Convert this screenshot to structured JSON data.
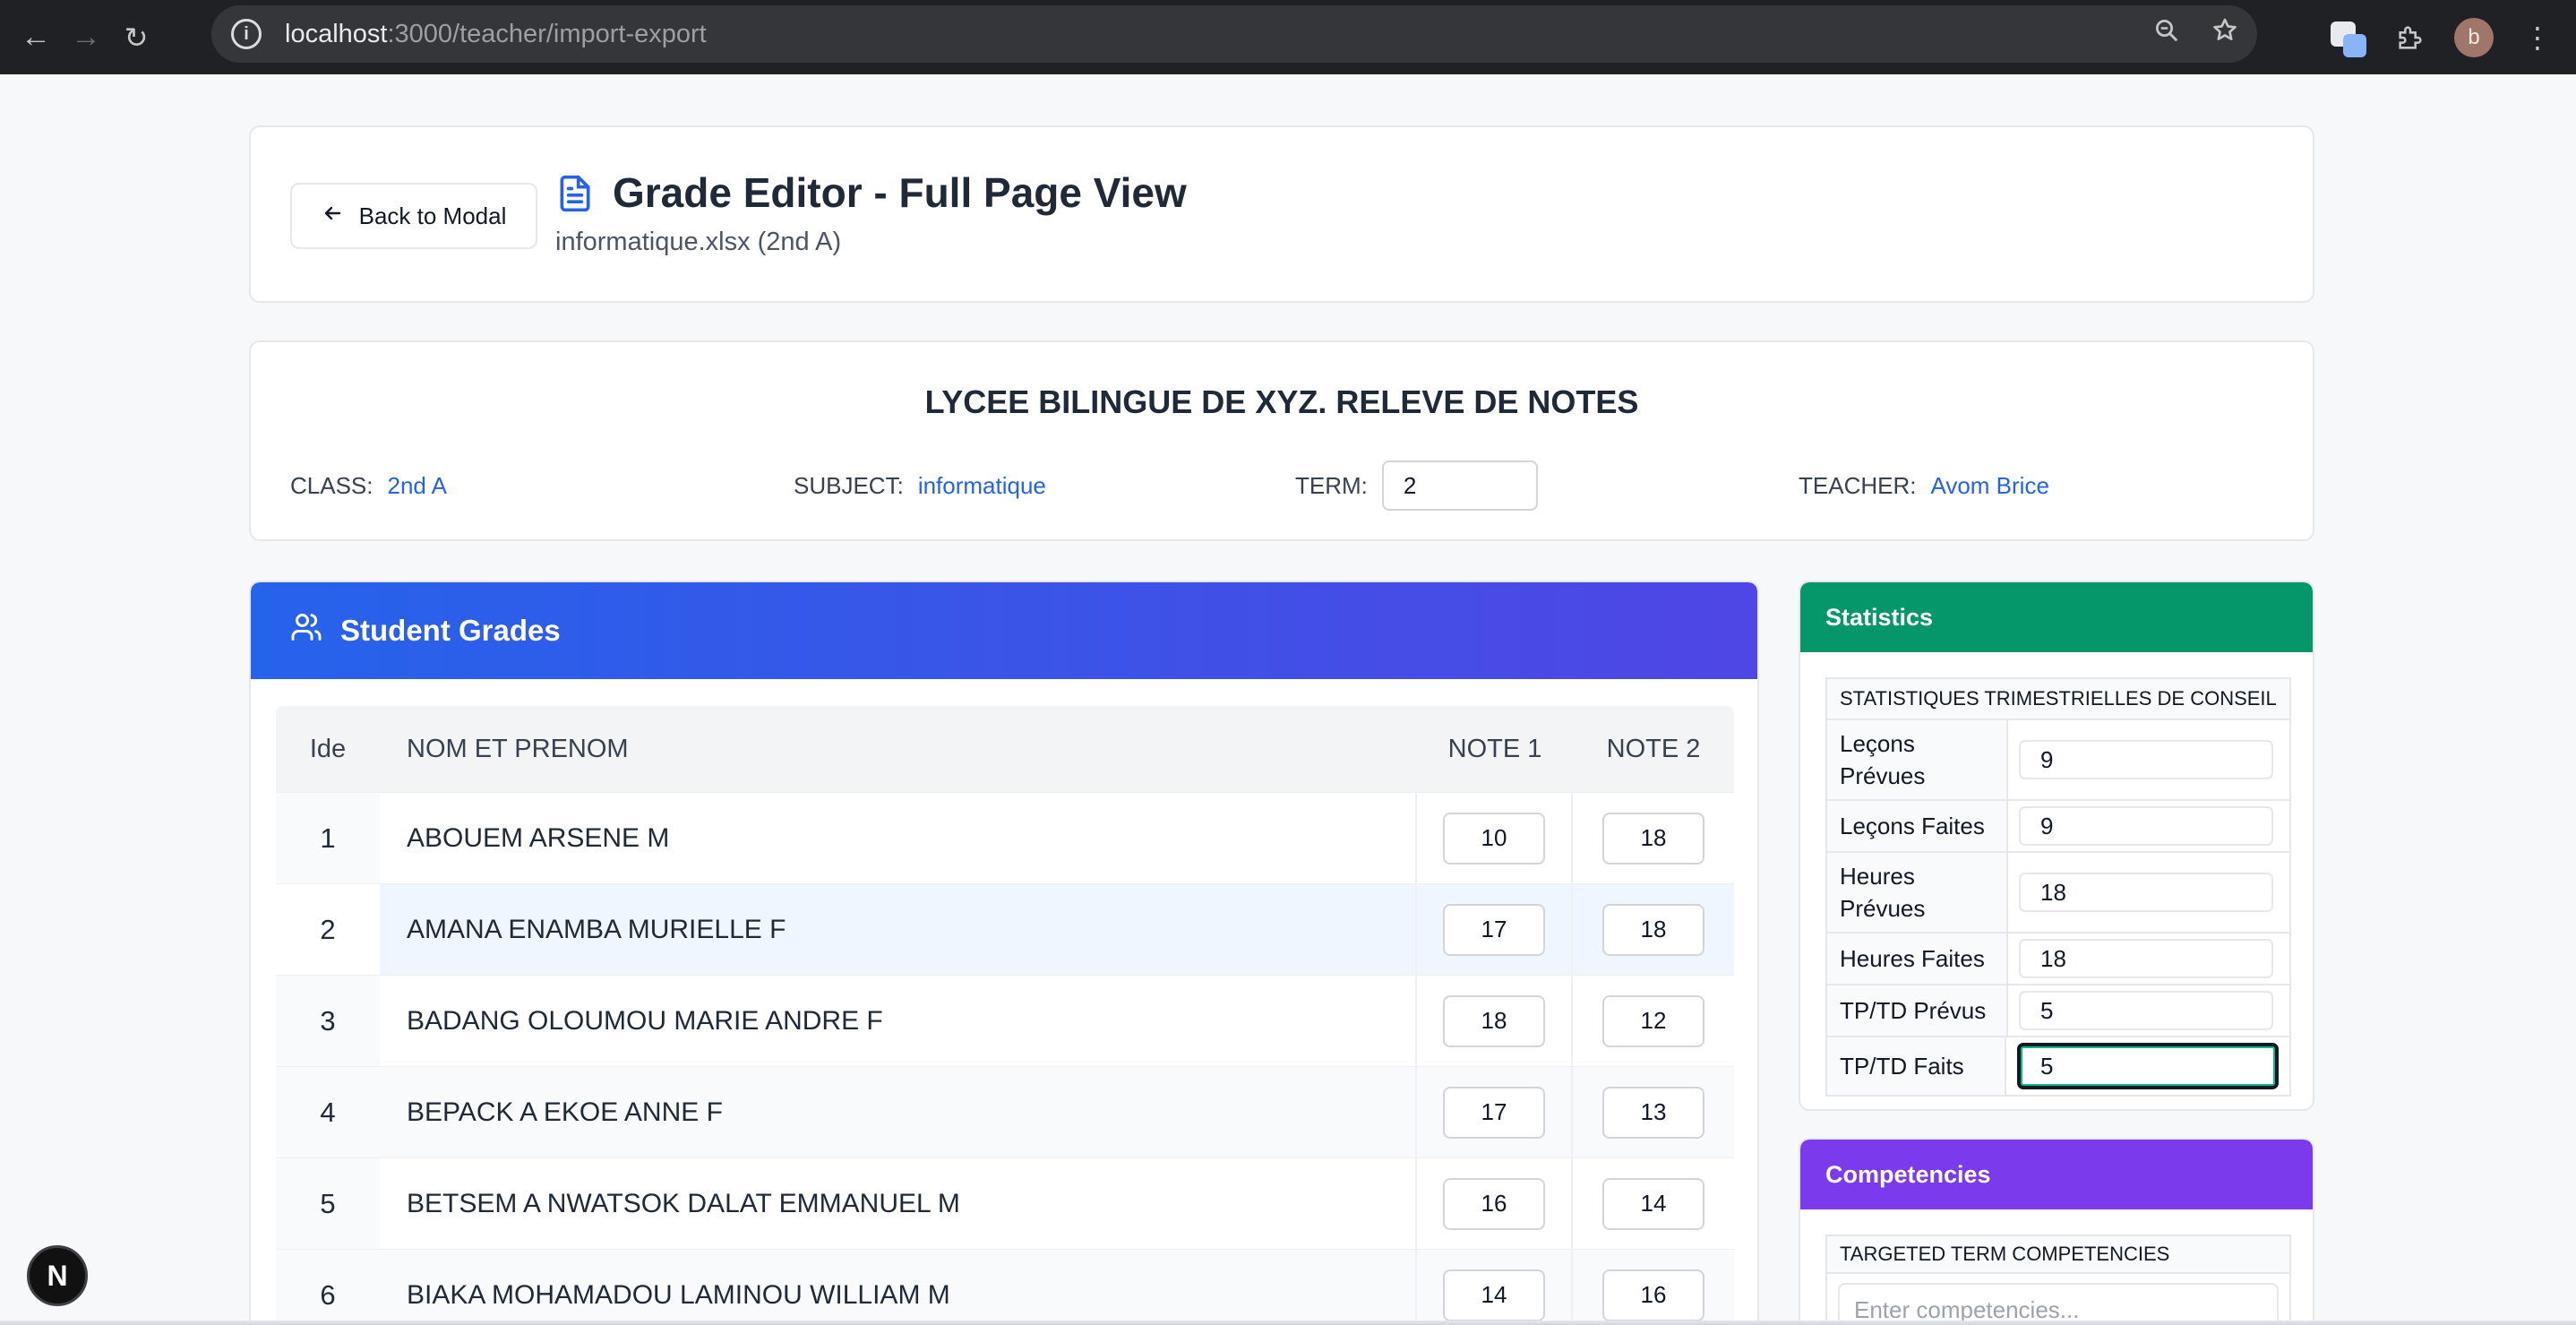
{
  "browser": {
    "url_host": "localhost",
    "url_path": ":3000/teacher/import-export",
    "profile_initial": "b"
  },
  "header": {
    "back_label": "Back to Modal",
    "title": "Grade Editor - Full Page View",
    "subtitle": "informatique.xlsx (2nd A)"
  },
  "info": {
    "school_title": "LYCEE BILINGUE DE XYZ. RELEVE DE NOTES",
    "class_label": "CLASS:",
    "class_value": "2nd A",
    "subject_label": "SUBJECT:",
    "subject_value": "informatique",
    "term_label": "TERM:",
    "term_value": "2",
    "teacher_label": "TEACHER:",
    "teacher_value": "Avom Brice"
  },
  "grades": {
    "heading": "Student Grades",
    "columns": [
      "Ide",
      "NOM ET PRENOM",
      "NOTE 1",
      "NOTE 2"
    ],
    "rows": [
      {
        "id": "1",
        "name": "ABOUEM ARSENE M",
        "note1": "10",
        "note2": "18"
      },
      {
        "id": "2",
        "name": "AMANA ENAMBA MURIELLE F",
        "note1": "17",
        "note2": "18"
      },
      {
        "id": "3",
        "name": "BADANG OLOUMOU MARIE ANDRE F",
        "note1": "18",
        "note2": "12"
      },
      {
        "id": "4",
        "name": "BEPACK A EKOE ANNE F",
        "note1": "17",
        "note2": "13"
      },
      {
        "id": "5",
        "name": "BETSEM A NWATSOK DALAT EMMANUEL M",
        "note1": "16",
        "note2": "14"
      },
      {
        "id": "6",
        "name": "BIAKA MOHAMADOU LAMINOU WILLIAM M",
        "note1": "14",
        "note2": "16"
      }
    ]
  },
  "statistics": {
    "heading": "Statistics",
    "table_title": "STATISTIQUES TRIMESTRIELLES DE CONSEIL",
    "rows": [
      {
        "label": "Leçons Prévues",
        "value": "9"
      },
      {
        "label": "Leçons Faites",
        "value": "9"
      },
      {
        "label": "Heures Prévues",
        "value": "18"
      },
      {
        "label": "Heures Faites",
        "value": "18"
      },
      {
        "label": "TP/TD Prévus",
        "value": "5"
      },
      {
        "label": "TP/TD Faits",
        "value": "5"
      }
    ]
  },
  "competencies": {
    "heading": "Competencies",
    "box_title": "TARGETED TERM COMPETENCIES",
    "placeholder": "Enter competencies..."
  },
  "dev_badge": "N",
  "colors": {
    "grades_gradient_start": "#2563eb",
    "grades_gradient_end": "#4f46e5",
    "statistics_header": "#059669",
    "competencies_header": "#7c3aed",
    "link_blue": "#2563eb"
  }
}
